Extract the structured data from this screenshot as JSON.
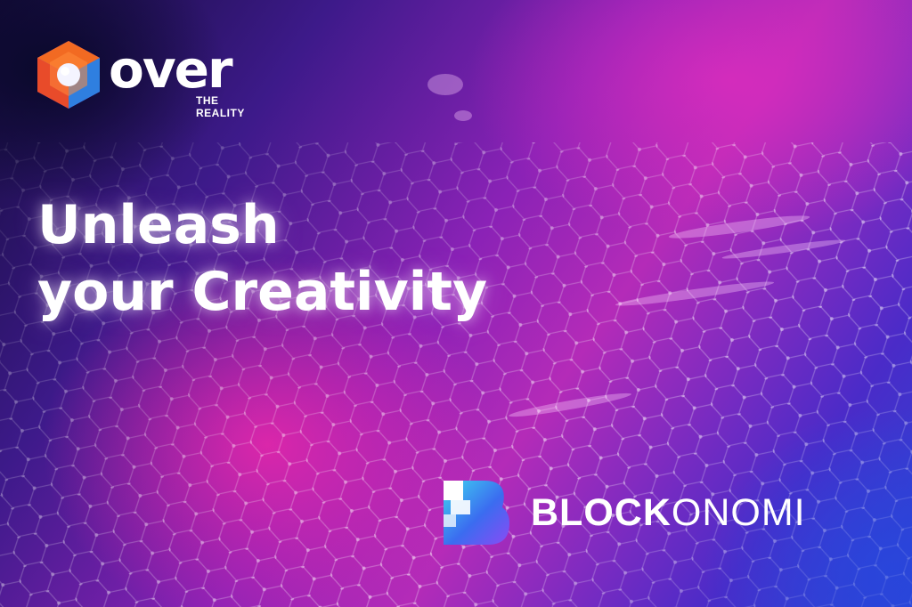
{
  "over_logo": {
    "wordmark": "over",
    "tagline": "THE REALITY",
    "icon": "cube-icon",
    "colors": {
      "orange": "#f26a22",
      "blue": "#2f7fe0",
      "purple": "#7a3fd0"
    }
  },
  "headline": {
    "line1": "Unleash",
    "line2": "your Creativity"
  },
  "blockonomi_logo": {
    "wordmark_bold": "BLOCK",
    "wordmark_light": "ONOMI",
    "icon": "blockonomi-b-icon",
    "colors": {
      "cyan": "#3fd6f0",
      "blue": "#3b6cf0",
      "violet": "#8a4bf5"
    }
  },
  "background": {
    "colors": {
      "deep": "#140c3a",
      "magenta": "#e028aa",
      "violet": "#8a22b6",
      "blue": "#2a46d6"
    }
  }
}
